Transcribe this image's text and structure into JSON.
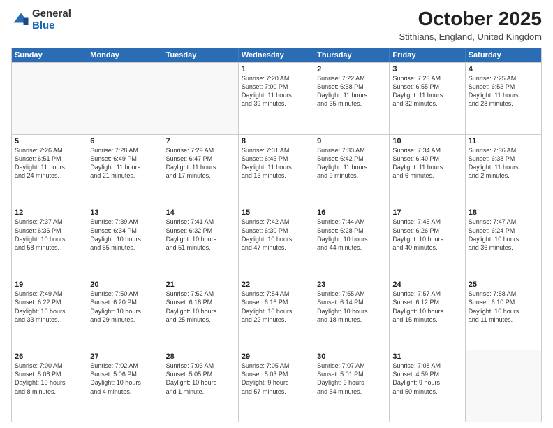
{
  "logo": {
    "general": "General",
    "blue": "Blue"
  },
  "title": "October 2025",
  "subtitle": "Stithians, England, United Kingdom",
  "headers": [
    "Sunday",
    "Monday",
    "Tuesday",
    "Wednesday",
    "Thursday",
    "Friday",
    "Saturday"
  ],
  "rows": [
    [
      {
        "day": "",
        "text": "",
        "empty": true
      },
      {
        "day": "",
        "text": "",
        "empty": true
      },
      {
        "day": "",
        "text": "",
        "empty": true
      },
      {
        "day": "1",
        "text": "Sunrise: 7:20 AM\nSunset: 7:00 PM\nDaylight: 11 hours\nand 39 minutes."
      },
      {
        "day": "2",
        "text": "Sunrise: 7:22 AM\nSunset: 6:58 PM\nDaylight: 11 hours\nand 35 minutes."
      },
      {
        "day": "3",
        "text": "Sunrise: 7:23 AM\nSunset: 6:55 PM\nDaylight: 11 hours\nand 32 minutes."
      },
      {
        "day": "4",
        "text": "Sunrise: 7:25 AM\nSunset: 6:53 PM\nDaylight: 11 hours\nand 28 minutes."
      }
    ],
    [
      {
        "day": "5",
        "text": "Sunrise: 7:26 AM\nSunset: 6:51 PM\nDaylight: 11 hours\nand 24 minutes."
      },
      {
        "day": "6",
        "text": "Sunrise: 7:28 AM\nSunset: 6:49 PM\nDaylight: 11 hours\nand 21 minutes."
      },
      {
        "day": "7",
        "text": "Sunrise: 7:29 AM\nSunset: 6:47 PM\nDaylight: 11 hours\nand 17 minutes."
      },
      {
        "day": "8",
        "text": "Sunrise: 7:31 AM\nSunset: 6:45 PM\nDaylight: 11 hours\nand 13 minutes."
      },
      {
        "day": "9",
        "text": "Sunrise: 7:33 AM\nSunset: 6:42 PM\nDaylight: 11 hours\nand 9 minutes."
      },
      {
        "day": "10",
        "text": "Sunrise: 7:34 AM\nSunset: 6:40 PM\nDaylight: 11 hours\nand 6 minutes."
      },
      {
        "day": "11",
        "text": "Sunrise: 7:36 AM\nSunset: 6:38 PM\nDaylight: 11 hours\nand 2 minutes."
      }
    ],
    [
      {
        "day": "12",
        "text": "Sunrise: 7:37 AM\nSunset: 6:36 PM\nDaylight: 10 hours\nand 58 minutes."
      },
      {
        "day": "13",
        "text": "Sunrise: 7:39 AM\nSunset: 6:34 PM\nDaylight: 10 hours\nand 55 minutes."
      },
      {
        "day": "14",
        "text": "Sunrise: 7:41 AM\nSunset: 6:32 PM\nDaylight: 10 hours\nand 51 minutes."
      },
      {
        "day": "15",
        "text": "Sunrise: 7:42 AM\nSunset: 6:30 PM\nDaylight: 10 hours\nand 47 minutes."
      },
      {
        "day": "16",
        "text": "Sunrise: 7:44 AM\nSunset: 6:28 PM\nDaylight: 10 hours\nand 44 minutes."
      },
      {
        "day": "17",
        "text": "Sunrise: 7:45 AM\nSunset: 6:26 PM\nDaylight: 10 hours\nand 40 minutes."
      },
      {
        "day": "18",
        "text": "Sunrise: 7:47 AM\nSunset: 6:24 PM\nDaylight: 10 hours\nand 36 minutes."
      }
    ],
    [
      {
        "day": "19",
        "text": "Sunrise: 7:49 AM\nSunset: 6:22 PM\nDaylight: 10 hours\nand 33 minutes."
      },
      {
        "day": "20",
        "text": "Sunrise: 7:50 AM\nSunset: 6:20 PM\nDaylight: 10 hours\nand 29 minutes."
      },
      {
        "day": "21",
        "text": "Sunrise: 7:52 AM\nSunset: 6:18 PM\nDaylight: 10 hours\nand 25 minutes."
      },
      {
        "day": "22",
        "text": "Sunrise: 7:54 AM\nSunset: 6:16 PM\nDaylight: 10 hours\nand 22 minutes."
      },
      {
        "day": "23",
        "text": "Sunrise: 7:55 AM\nSunset: 6:14 PM\nDaylight: 10 hours\nand 18 minutes."
      },
      {
        "day": "24",
        "text": "Sunrise: 7:57 AM\nSunset: 6:12 PM\nDaylight: 10 hours\nand 15 minutes."
      },
      {
        "day": "25",
        "text": "Sunrise: 7:58 AM\nSunset: 6:10 PM\nDaylight: 10 hours\nand 11 minutes."
      }
    ],
    [
      {
        "day": "26",
        "text": "Sunrise: 7:00 AM\nSunset: 5:08 PM\nDaylight: 10 hours\nand 8 minutes."
      },
      {
        "day": "27",
        "text": "Sunrise: 7:02 AM\nSunset: 5:06 PM\nDaylight: 10 hours\nand 4 minutes."
      },
      {
        "day": "28",
        "text": "Sunrise: 7:03 AM\nSunset: 5:05 PM\nDaylight: 10 hours\nand 1 minute."
      },
      {
        "day": "29",
        "text": "Sunrise: 7:05 AM\nSunset: 5:03 PM\nDaylight: 9 hours\nand 57 minutes."
      },
      {
        "day": "30",
        "text": "Sunrise: 7:07 AM\nSunset: 5:01 PM\nDaylight: 9 hours\nand 54 minutes."
      },
      {
        "day": "31",
        "text": "Sunrise: 7:08 AM\nSunset: 4:59 PM\nDaylight: 9 hours\nand 50 minutes."
      },
      {
        "day": "",
        "text": "",
        "empty": true
      }
    ]
  ]
}
